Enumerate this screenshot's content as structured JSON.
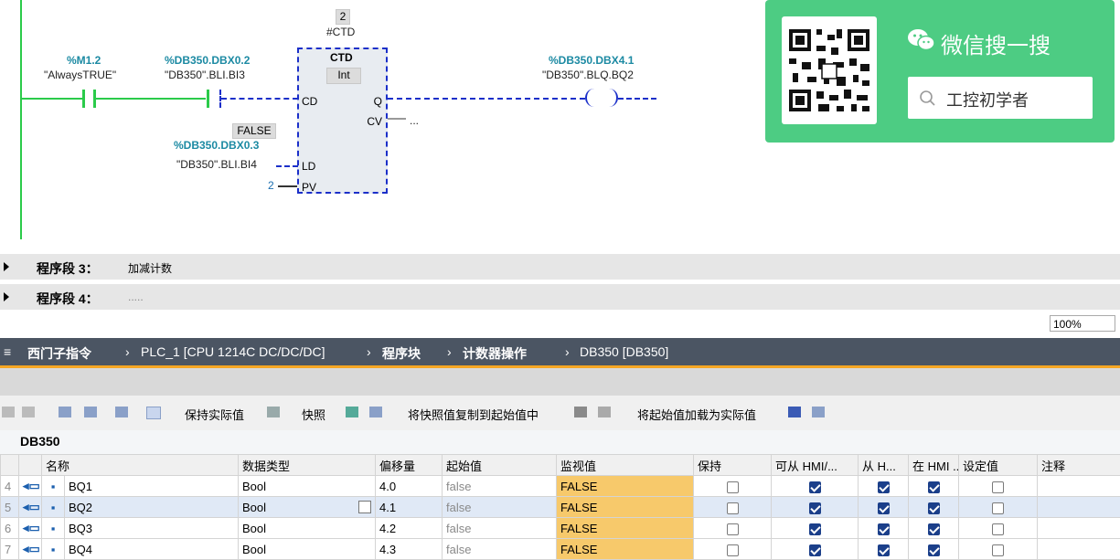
{
  "ladder": {
    "instance_num": "2",
    "instance_name": "#CTD",
    "m12_addr": "%M1.2",
    "m12_sym": "\"AlwaysTRUE\"",
    "bi3_addr": "%DB350.DBX0.2",
    "bi3_sym": "\"DB350\".BLI.BI3",
    "ctd_title": "CTD",
    "ctd_type": "Int",
    "pin_cd": "CD",
    "pin_q": "Q",
    "pin_cv": "CV",
    "cv_value": "...",
    "pin_ld": "LD",
    "pin_pv": "PV",
    "false_label": "FALSE",
    "bi4_addr": "%DB350.DBX0.3",
    "bi4_sym": "\"DB350\".BLI.BI4",
    "pv_value": "2",
    "bq2_addr": "%DB350.DBX4.1",
    "bq2_sym": "\"DB350\".BLQ.BQ2"
  },
  "wechat": {
    "title": "微信搜一搜",
    "search_text": "工控初学者"
  },
  "segments": [
    {
      "label": "程序段 3：",
      "desc": "加减计数"
    },
    {
      "label": "程序段 4：",
      "desc": "....."
    }
  ],
  "zoom": "100%",
  "breadcrumb": [
    "西门子指令",
    "PLC_1 [CPU 1214C DC/DC/DC]",
    "程序块",
    "计数器操作",
    "DB350 [DB350]"
  ],
  "toolbar": {
    "keep_actual": "保持实际值",
    "snapshot": "快照",
    "copy_snapshot": "将快照值复制到起始值中",
    "load_start": "将起始值加载为实际值"
  },
  "db_title": "DB350",
  "table": {
    "headers": [
      "名称",
      "数据类型",
      "偏移量",
      "起始值",
      "监视值",
      "保持",
      "可从 HMI/...",
      "从 H...",
      "在 HMI ...",
      "设定值",
      "注释"
    ],
    "rows": [
      {
        "idx": "4",
        "name": "BQ1",
        "type": "Bool",
        "offset": "4.0",
        "start": "false",
        "monitor": "FALSE"
      },
      {
        "idx": "5",
        "name": "BQ2",
        "type": "Bool",
        "offset": "4.1",
        "start": "false",
        "monitor": "FALSE"
      },
      {
        "idx": "6",
        "name": "BQ3",
        "type": "Bool",
        "offset": "4.2",
        "start": "false",
        "monitor": "FALSE"
      },
      {
        "idx": "7",
        "name": "BQ4",
        "type": "Bool",
        "offset": "4.3",
        "start": "false",
        "monitor": "FALSE"
      }
    ]
  }
}
